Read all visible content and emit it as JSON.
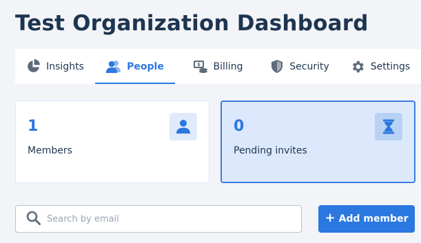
{
  "page": {
    "title": "Test Organization Dashboard"
  },
  "tabs": [
    {
      "label": "Insights",
      "icon": "pie-chart-icon",
      "active": false
    },
    {
      "label": "People",
      "icon": "people-icon",
      "active": true
    },
    {
      "label": "Billing",
      "icon": "billing-icon",
      "active": false
    },
    {
      "label": "Security",
      "icon": "shield-icon",
      "active": false
    },
    {
      "label": "Settings",
      "icon": "gear-icon",
      "active": false
    }
  ],
  "stats": {
    "members": {
      "value": "1",
      "label": "Members",
      "icon": "user-icon"
    },
    "pending_invites": {
      "value": "0",
      "label": "Pending invites",
      "icon": "hourglass-icon"
    }
  },
  "search": {
    "placeholder": "Search by email",
    "value": ""
  },
  "actions": {
    "add_member_label": "Add member",
    "add_member_icon": "plus-icon"
  },
  "colors": {
    "accent": "#2b78e0",
    "heading": "#1e3550",
    "background": "#f2f4f8",
    "selected_card_bg": "#dce9fc"
  }
}
